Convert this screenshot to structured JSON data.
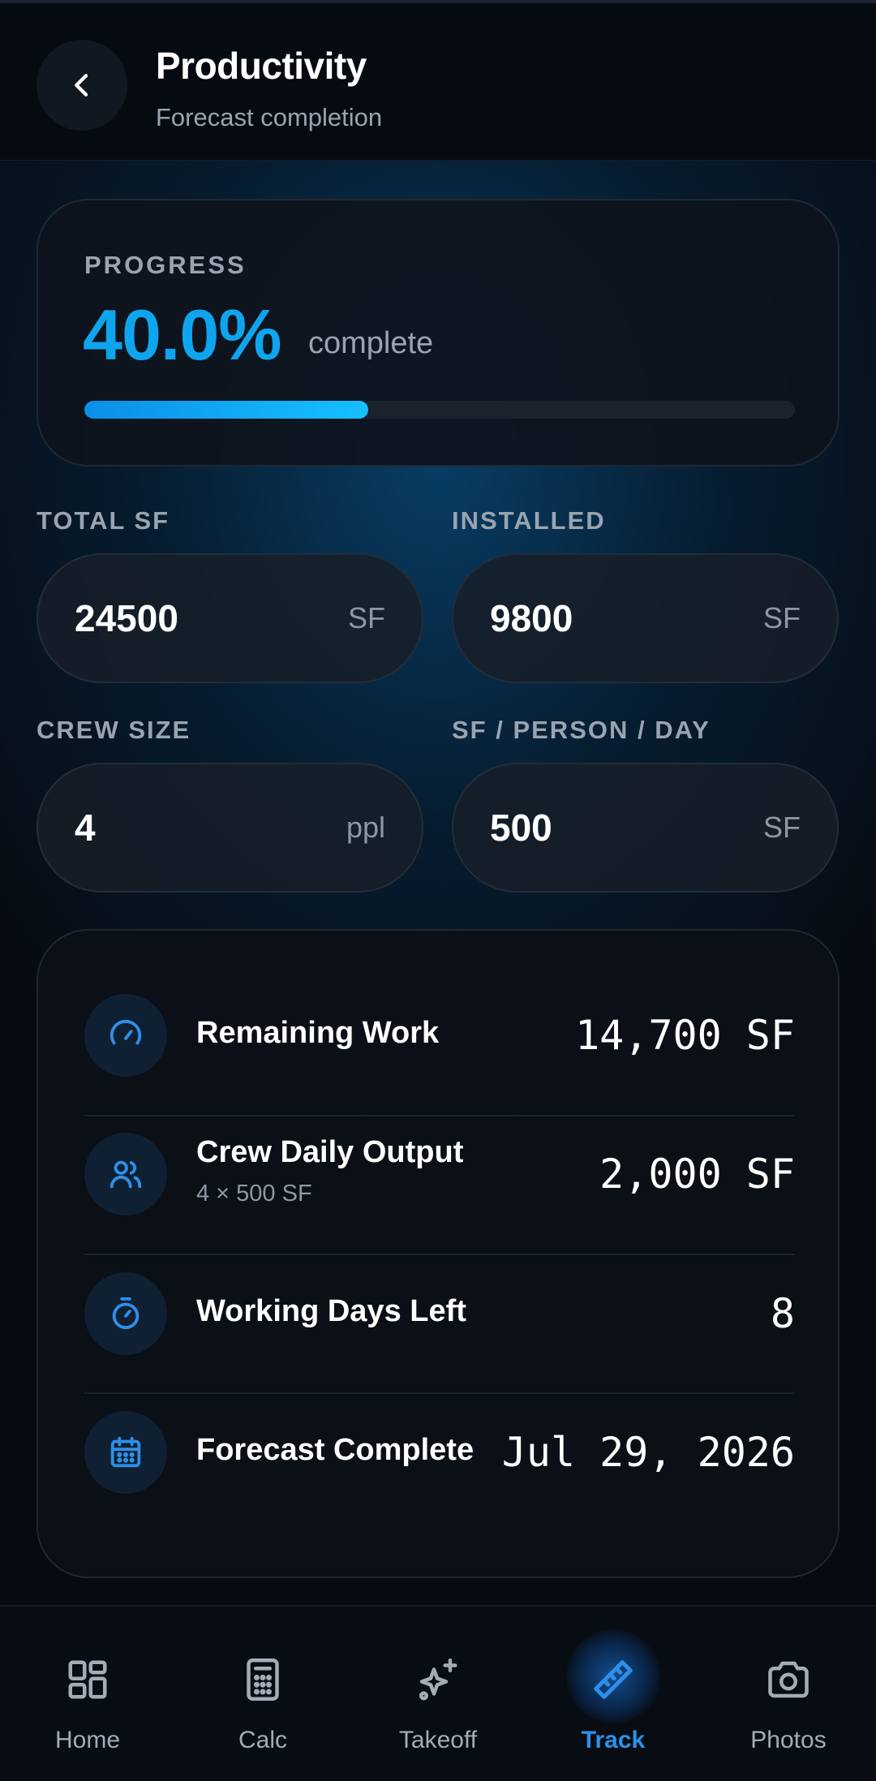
{
  "header": {
    "title": "Productivity",
    "subtitle": "Forecast completion"
  },
  "progress": {
    "label": "PROGRESS",
    "percent_text": "40.0%",
    "suffix": "complete",
    "fraction": 0.4,
    "accent_color": "#0ea5ee"
  },
  "fields": {
    "total_sf": {
      "label": "TOTAL SF",
      "value": "24500",
      "unit": "SF"
    },
    "installed": {
      "label": "INSTALLED",
      "value": "9800",
      "unit": "SF"
    },
    "crew_size": {
      "label": "CREW SIZE",
      "value": "4",
      "unit": "ppl"
    },
    "sf_per_person_day": {
      "label": "SF / PERSON / DAY",
      "value": "500",
      "unit": "SF"
    }
  },
  "results": {
    "rows": [
      {
        "icon": "gauge-icon",
        "label": "Remaining Work",
        "sub": "",
        "value": "14,700 SF"
      },
      {
        "icon": "users-icon",
        "label": "Crew Daily Output",
        "sub": "4 × 500 SF",
        "value": "2,000 SF"
      },
      {
        "icon": "timer-icon",
        "label": "Working Days Left",
        "sub": "",
        "value": "8"
      },
      {
        "icon": "calendar-icon",
        "label": "Forecast Complete",
        "sub": "",
        "value": "Jul 29, 2026"
      }
    ]
  },
  "nav": {
    "active": "Track",
    "active_color": "#2f8fe8",
    "items": [
      {
        "icon": "grid-icon",
        "label": "Home"
      },
      {
        "icon": "calculator-icon",
        "label": "Calc"
      },
      {
        "icon": "sparkles-icon",
        "label": "Takeoff"
      },
      {
        "icon": "ruler-icon",
        "label": "Track"
      },
      {
        "icon": "camera-icon",
        "label": "Photos"
      }
    ]
  }
}
